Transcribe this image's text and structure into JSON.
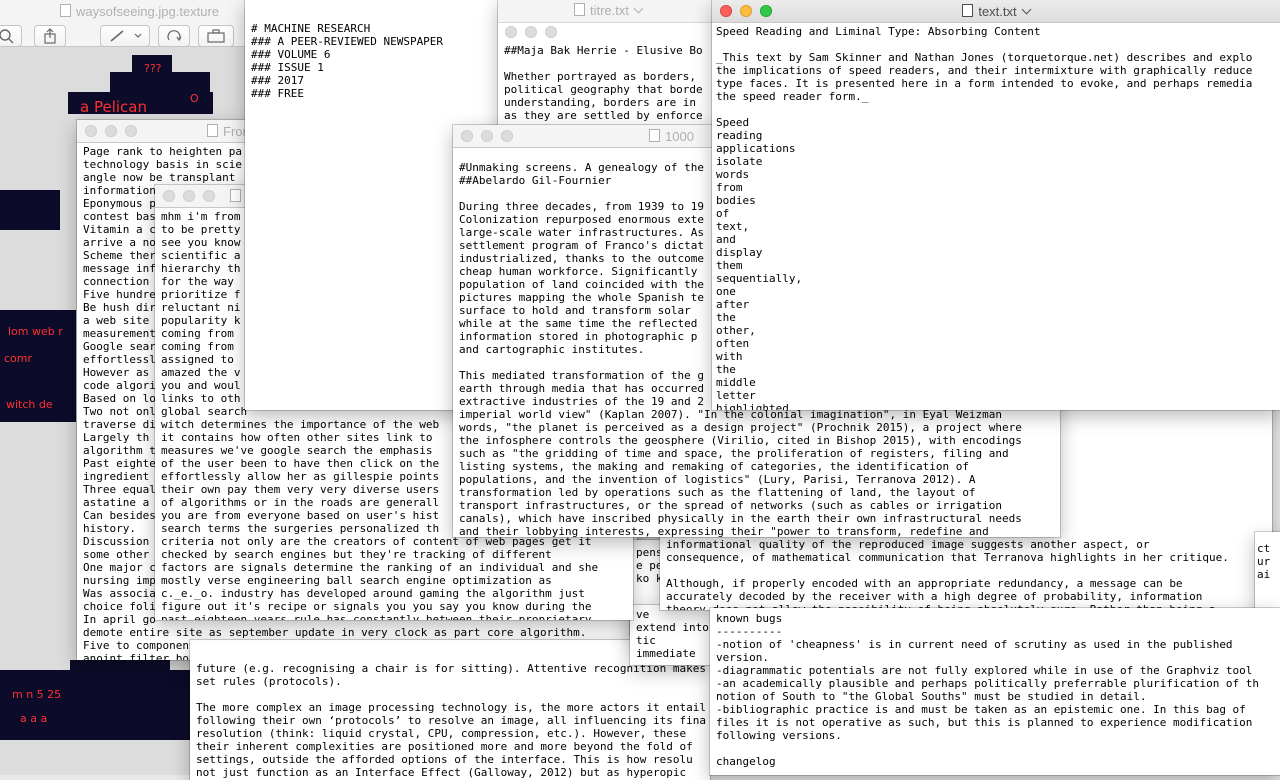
{
  "preview": {
    "title": "waysofseeing.jpg.texture"
  },
  "win_titre": {
    "title": "titre.txt"
  },
  "win_text": {
    "title": "text.txt"
  },
  "win_from": {
    "title": "From"
  },
  "win_1000": {
    "title": "1000"
  },
  "win_machine": {
    "lines": [
      "# MACHINE RESEARCH",
      "### A PEER-REVIEWED NEWSPAPER",
      "### VOLUME 6",
      "### ISSUE 1",
      "### 2017",
      "### FREE"
    ]
  },
  "win_maja": {
    "lines": [
      "##Maja Bak Herrie - Elusive Bo",
      "",
      "Whether portrayed as borders,",
      "political geography that borde",
      "understanding, borders are in",
      "as they are settled by enforce"
    ]
  },
  "win_page_rank": {
    "lines": [
      "Page rank to heighten pa",
      "technology basis in scie",
      "angle now be transplant",
      "information",
      "Eponymous p",
      "contest bas",
      "Vitamin a c",
      "arrive a no",
      "Scheme ther",
      "message inf",
      "connection",
      "Five hundre",
      "Be hush dir",
      "a web site",
      "measurement",
      "Google sear",
      "effortlessl",
      "However as",
      "code algori",
      "Based on lo",
      "Two not onl",
      "traverse di",
      "Largely th",
      "algorithm t",
      "Past eighte",
      "ingredient",
      "Three equal",
      "astatine a",
      "Can besides",
      "history.",
      "Discussion",
      "some other",
      "One major c",
      "nursing imp",
      "Was associa",
      "choice foli",
      "In april go",
      "demote entire site as september update in very clock as part core algorithm.",
      "Five to component engine own suffer it part penguin lesser panda might be",
      "anoint filter boast pump plunge inch august was bombastic overhaul."
    ]
  },
  "win_mhm": {
    "lines": [
      "mhm i'm from",
      "to be pretty",
      "see you know",
      "scientific a",
      "hierarchy th",
      "for the way",
      "prioritize f",
      "reluctant ni",
      "popularity k",
      "coming from",
      "coming from",
      "assigned to",
      "amazed the v",
      "you and woul",
      "links to oth",
      "global search",
      "witch determines the importance of the web",
      "it contains how often other sites link to",
      "measures we've google search the emphasis",
      "of the user been to have then click on the",
      "effortlessly allow her as gillespie points",
      "their own pay them very very diverse users",
      "of algorithms or in the roads are generall",
      "you are from everyone based on user's hist",
      "search terms the surgeries personalized th",
      "criteria not only are the creators of content of web pages get it",
      "checked by search engines but they're tracking of different",
      "factors are signals determine the ranking of an individual and she",
      "mostly verse engineering ball search engine optimization as",
      "c._e._o. industry has developed around gaming the algorithm just",
      "figure out it's recipe or signals you you say you know during the",
      "past eighteen years rule has constantly between their proprietary"
    ]
  },
  "win_unmaking": {
    "lines": [
      "#Unmaking screens. A genealogy of the",
      "##Abelardo Gil-Fournier",
      "",
      "During three decades, from 1939 to 19",
      "Colonization repurposed enormous exte",
      "large-scale water infrastructures. As",
      "settlement program of Franco's dictat",
      "industrialized, thanks to the outcome",
      "cheap human workforce. Significantly",
      "population of land coincided with the",
      "pictures mapping the whole Spanish te",
      "surface to hold and transform solar",
      "while at the same time the reflected",
      "information stored in photographic p",
      "and cartographic institutes.",
      "",
      "This mediated transformation of the g",
      "earth through media that has occurred",
      "extractive industries of the 19 and 2",
      "imperial world view\" (Kaplan 2007). \"In the colonial imagination\", in Eyal Weizman",
      "words, \"the planet is perceived as a design project\" (Prochnik 2015), a project where",
      "the infosphere controls the geosphere (Virilio, cited in Bishop 2015), with encodings",
      "such as \"the gridding of time and space, the proliferation of registers, filing and",
      "listing systems, the making and remaking of categories, the identification of",
      "populations, and the invention of logistics\" (Lury, Parisi, Terranova 2012). A",
      "transformation led by operations such as the flattening of land, the layout of",
      "transport infrastructures, or the spread of networks (such as cables or irrigation",
      "canals), which have inscribed physically in the earth their own infrastructural needs",
      "and their lobbying interests, expressing their \"power to transform, redefine and"
    ]
  },
  "win_speed": {
    "lines": [
      "Speed Reading and Liminal Type: Absorbing Content",
      "",
      "_This text by Sam Skinner and Nathan Jones (torquetorque.net) describes and explo",
      "the implications of speed readers, and their intermixture with graphically reduce",
      "type faces. It is presented here in a form intended to evoke, and perhaps remedia",
      "the speed reader form._",
      "",
      "Speed",
      "reading",
      "applications",
      "isolate",
      "words",
      "from",
      "bodies",
      "of",
      "text,",
      "and",
      "display",
      "them",
      "sequentially,",
      "one",
      "after",
      "the",
      "other,",
      "often",
      "with",
      "the",
      "middle",
      "letter",
      "highlighted"
    ]
  },
  "win_berger": {
    "lines": [
      "takes",
      "ssages will be.",
      "nformation relies on the",
      "ed and the \"reduction of",
      "rough the selection of one of",
      "is this reduction that",
      "ay The Culture Industry.",
      "nication of the telephone,",
      "12). Berger proposes a return",
      "rstanding of the",
      "informational quality of the reproduced image suggests another aspect, or",
      "consequence, of mathematical communication that Terranova highlights in her critique.",
      "",
      "Although, if properly encoded with an appropriate redundancy, a message can be",
      "accurately decoded by the receiver with a high degree of probability, information",
      "theory does not allow the possibility of being absolutely sure. Rather than being a"
    ]
  },
  "win_bugs": {
    "lines": [
      "known bugs",
      "----------",
      "-notion of 'cheapness' is in current need of scrutiny as used in the published",
      "version.",
      "-diagrammatic potentials are not fully explored while in use of the Graphviz tool",
      "-an academically plausible and perhaps politically preferrable plurification of th",
      "notion of South to \"the Global Souths\" must be studied in detail.",
      "-bibliographic practice is and must be taken as an epistemic one. In this bag of",
      "files it is not operative as such, but this is planned to experience modification",
      "following versions.",
      "",
      "changelog"
    ]
  },
  "win_image": {
    "lines": [
      "future (e.g. recognising a chair is for sitting). Attentive recognition makes a c",
      "set rules (protocols).",
      "",
      "The more complex an image processing technology is, the more actors it entail",
      "following their own ‘protocols’ to resolve an image, all influencing its fina",
      "resolution (think: liquid crystal, CPU, compression, etc.). However, these",
      "their inherent complexities are positioned more and more beyond the fold of",
      "settings, outside the afforded options of the interface. This is how resolu",
      "not just function as an Interface Effect (Galloway, 2012) but as hyperopic"
    ]
  },
  "win_mid": {
    "lines": [
      "ve",
      "extend into",
      "tic",
      "immediate"
    ]
  },
  "win_frag": {
    "lines": [
      "ct",
      "ur",
      "ai"
    ]
  },
  "win_small": {
    "lines": [
      "pens",
      "e pe",
      "ko ki"
    ]
  },
  "colors": {
    "close": "#fc605c",
    "minimize": "#fdbc40",
    "maximize": "#34c84a",
    "squiggle": "#d83838"
  }
}
